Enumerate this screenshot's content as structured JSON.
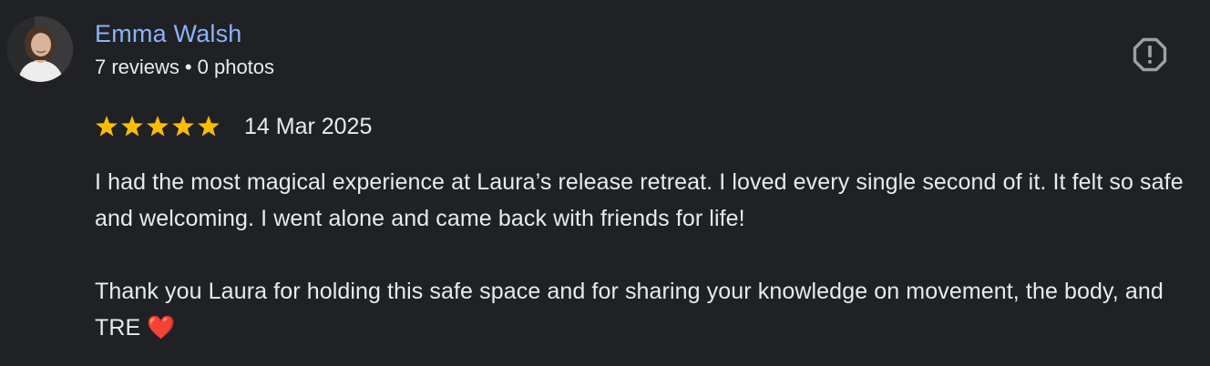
{
  "review": {
    "author": {
      "name": "Emma Walsh",
      "reviews_count": "7 reviews",
      "separator": "•",
      "photos_count": "0 photos",
      "avatar_icon": "user-avatar-photo"
    },
    "report_icon": "report-octagon-icon",
    "rating": {
      "value": 5,
      "max": 5,
      "star_color": "#fbbc04"
    },
    "date": "14 Mar 2025",
    "body": {
      "paragraph_1": "I had the most magical experience at Laura’s release retreat. I loved every single second of it. It felt so safe and welcoming. I went alone and came back with friends for life!",
      "paragraph_2": "Thank you Laura for holding this safe space and for sharing your knowledge on movement, the body, and TRE ❤️"
    }
  },
  "colors": {
    "background": "#202124",
    "link": "#8ab4f8",
    "text": "#e8eaed",
    "icon": "#9aa0a6"
  }
}
